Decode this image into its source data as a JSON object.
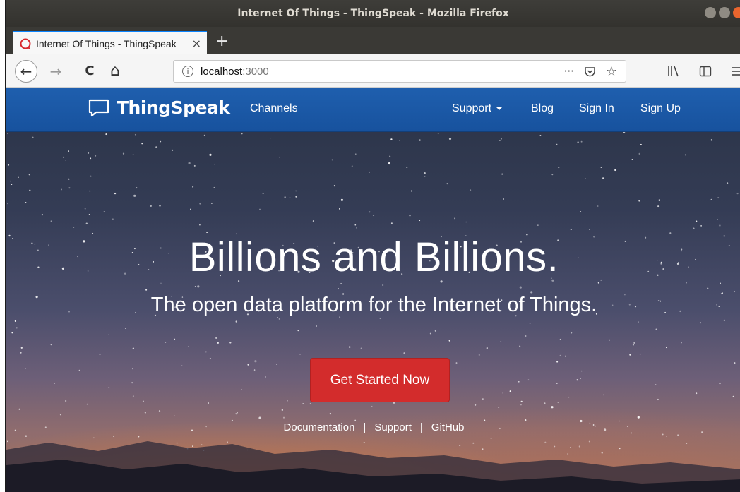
{
  "window": {
    "title": "Internet Of Things - ThingSpeak - Mozilla Firefox"
  },
  "tabs": [
    {
      "title": "Internet Of Things - ThingSpeak",
      "favicon": "thingspeak-favicon-icon",
      "close": "×"
    }
  ],
  "new_tab_label": "+",
  "nav": {
    "back": "←",
    "forward": "→",
    "reload": "C",
    "home": "⌂",
    "url_host": "localhost",
    "url_port": ":3000",
    "info_icon": "i",
    "more_label": "···",
    "pocket_icon": "pocket-icon",
    "bookmark_icon": "star-icon",
    "library_icon": "library-icon",
    "sidebar_icon": "sidebar-icon",
    "menu_icon": "hamburger-menu-icon"
  },
  "site_nav": {
    "brand": "ThingSpeak",
    "channels": "Channels",
    "support": "Support",
    "blog": "Blog",
    "sign_in": "Sign In",
    "sign_up": "Sign Up"
  },
  "hero": {
    "title": "Billions and Billions.",
    "subtitle": "The open data platform for the Internet of Things.",
    "cta": "Get Started Now",
    "links": [
      "Documentation",
      "Support",
      "GitHub"
    ],
    "separator": "|"
  },
  "colors": {
    "site_nav_bg": "#1f5fae",
    "cta_bg": "#d32c2c",
    "firefox_accent": "#0a84ff",
    "favicon": "#d7262c"
  }
}
